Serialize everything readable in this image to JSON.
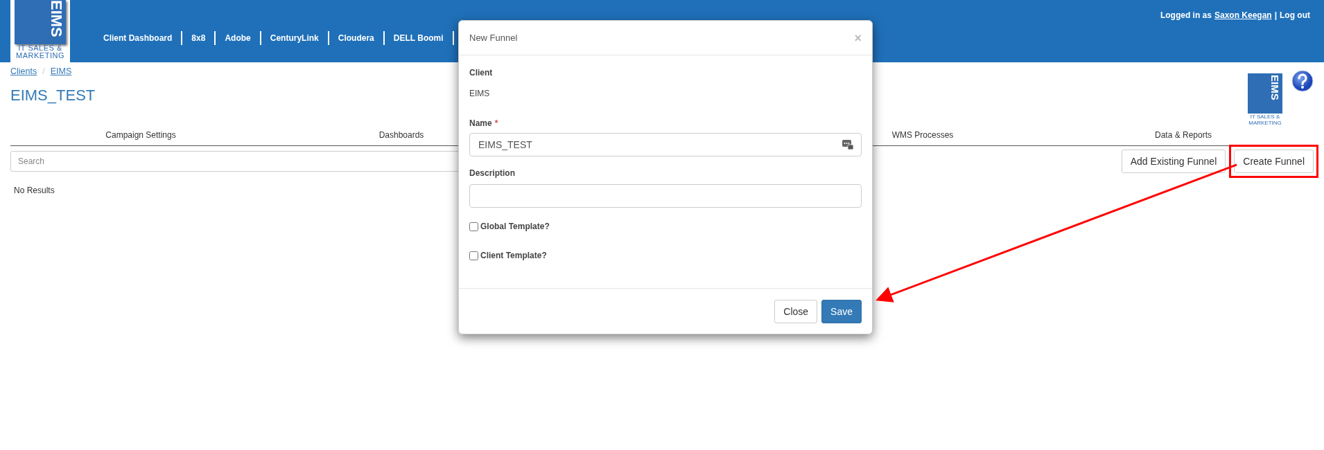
{
  "header": {
    "logo": {
      "mark": "EIMS",
      "lines": [
        "IT SALES &",
        "MARKETING"
      ]
    },
    "nav": [
      "Client Dashboard",
      "8x8",
      "Adobe",
      "CenturyLink",
      "Cloudera",
      "DELL Boomi"
    ],
    "user": {
      "prefix": "Logged in as",
      "name": "Saxon Keegan",
      "separator": "|",
      "logout": "Log out"
    }
  },
  "breadcrumbs": [
    "Clients",
    "EIMS"
  ],
  "breadcrumb_separator": "/",
  "page_title": "EIMS_TEST",
  "client_logo": {
    "mark": "EIMS",
    "lines": [
      "IT SALES &",
      "MARKETING"
    ]
  },
  "tabs": [
    {
      "label": "Campaign Settings",
      "selected": false
    },
    {
      "label": "Dashboards",
      "selected": false
    },
    {
      "label": "WMS Processes",
      "selected": false
    },
    {
      "label": "Data & Reports",
      "selected": false
    }
  ],
  "search": {
    "placeholder": "Search"
  },
  "buttons": [
    {
      "label": "Add Existing Funnel",
      "highlighted": false
    },
    {
      "label": "Create Funnel",
      "highlighted": true
    }
  ],
  "empty_message": "No Results",
  "dialog": {
    "title": "New Funnel",
    "close": "×",
    "client_label": "Client",
    "client_value": "EIMS",
    "name_label": "Name",
    "required_mark": "*",
    "name_value": "EIMS_TEST",
    "description_label": "Description",
    "checkboxes": [
      {
        "label": "Global Template?",
        "checked": false
      },
      {
        "label": "Client Template?",
        "checked": false
      }
    ],
    "footer_buttons": [
      {
        "label": "Close",
        "kind": "default"
      },
      {
        "label": "Save",
        "kind": "primary"
      }
    ]
  }
}
